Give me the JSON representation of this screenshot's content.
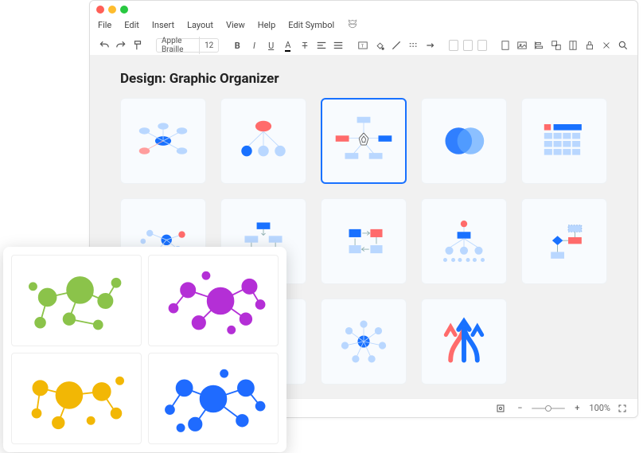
{
  "window": {
    "title": "Design: Graphic Organizer"
  },
  "menubar": {
    "items": [
      "File",
      "Edit",
      "Insert",
      "Layout",
      "View",
      "Help",
      "Edit Symbol"
    ]
  },
  "toolbar": {
    "font_name": "Apple Braille",
    "font_size": "12"
  },
  "statusbar": {
    "zoom_label": "100%"
  },
  "colors": {
    "brand_blue": "#1971ff",
    "light_blue": "#b9d7ff",
    "mid_blue": "#5ea6ff",
    "red": "#ff6b6b",
    "light_red": "#ffb3b3",
    "green": "#8bc34a",
    "purple": "#b42fd6",
    "yellow": "#f2b705"
  },
  "templates": [
    {
      "id": "brainstorm-1",
      "selected": false
    },
    {
      "id": "org-chart-1",
      "selected": false
    },
    {
      "id": "star-concept",
      "selected": true
    },
    {
      "id": "venn",
      "selected": false
    },
    {
      "id": "calendar-grid",
      "selected": false
    },
    {
      "id": "cluster-2",
      "selected": false
    },
    {
      "id": "flow-1",
      "selected": false
    },
    {
      "id": "cycle-1",
      "selected": false
    },
    {
      "id": "hierarchy-2",
      "selected": false
    },
    {
      "id": "decision-flow",
      "selected": false
    },
    {
      "id": "t-chart",
      "selected": false
    },
    {
      "id": "compare-panels",
      "selected": false
    },
    {
      "id": "radial-hub",
      "selected": false
    },
    {
      "id": "merge-arrows",
      "selected": false
    }
  ],
  "previews": [
    {
      "id": "network-green",
      "color": "#8bc34a"
    },
    {
      "id": "network-purple",
      "color": "#b42fd6"
    },
    {
      "id": "network-yellow",
      "color": "#f2b705"
    },
    {
      "id": "network-blue",
      "color": "#1f6bff"
    }
  ]
}
